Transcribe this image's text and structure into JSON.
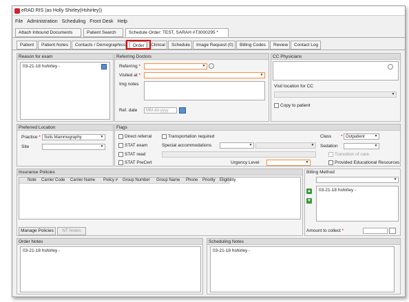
{
  "window": {
    "title": "eRAD RIS (as Holly Shirley(Hshirley))"
  },
  "menu": [
    "File",
    "Administration",
    "Scheduling",
    "Front Desk",
    "Help"
  ],
  "top_tabs": [
    {
      "label": "Attach Inbound Documents"
    },
    {
      "label": "Patient Search"
    },
    {
      "label": "Schedule Order: TEST, SARAH #T3000295 *"
    }
  ],
  "sub_tabs": [
    "Patient",
    "Patient Notes",
    "Contacts / Demographics",
    "Order",
    "Clinical",
    "Schedule",
    "Image Request (0)",
    "Billing Codes",
    "Review",
    "Contact Log"
  ],
  "active_sub_tab": "Order",
  "reason_for_exam": {
    "header": "Reason for exam",
    "text": "03-21-18 hshirley -"
  },
  "referring": {
    "header": "Referring Doctors",
    "referring_label": "Referring",
    "visited_at_label": "Visited at",
    "img_notes_label": "Img notes",
    "ref_date_label": "Ref. date",
    "ref_date_placeholder": "MM-dd-yyyy"
  },
  "cc_physicians": {
    "header": "CC Physicians",
    "visit_location_label": "Visit location for CC",
    "copy_to_patient": "Copy to patient"
  },
  "preferred_location": {
    "header": "Preferred Location",
    "practice_label": "Practice",
    "practice_value": "Solis Mammography",
    "site_label": "Site"
  },
  "flags": {
    "header": "Flags",
    "direct_referral": "Direct referral",
    "transportation_required": "Transportation required",
    "stat_exam": "STAT exam",
    "special_accommodations": "Special accommodations",
    "stat_read": "STAT read",
    "stat_precert": "STAT PreCert",
    "urgency_level": "Urgency Level",
    "class_label": "Class",
    "class_value": "Outpatient",
    "sedation_label": "Sedation",
    "transition_of_care": "Transition of care",
    "provided_educational_resources": "Provided Educational Resources"
  },
  "insurance": {
    "header": "Insurance Policies",
    "columns": [
      "Note",
      "Carrier Code",
      "Carrier Name",
      "Policy #",
      "Group Number",
      "Group Name",
      "Phone",
      "Priority",
      "Eligibility"
    ],
    "manage_policies": "Manage Policies",
    "nt_notes": "NT Notes"
  },
  "billing": {
    "header": "Billing Method",
    "notes_text": "03-21-18 hshirley -",
    "amount_label": "Amount to collect"
  },
  "order_notes": {
    "header": "Order Notes",
    "text": "03-21-18 hshirley -"
  },
  "scheduling_notes": {
    "header": "Scheduling Notes",
    "text": "03-21-18 hshirley -"
  },
  "colors": {
    "highlight": "#e00000",
    "required": "#dd0000",
    "input_focus": "#f09040"
  }
}
